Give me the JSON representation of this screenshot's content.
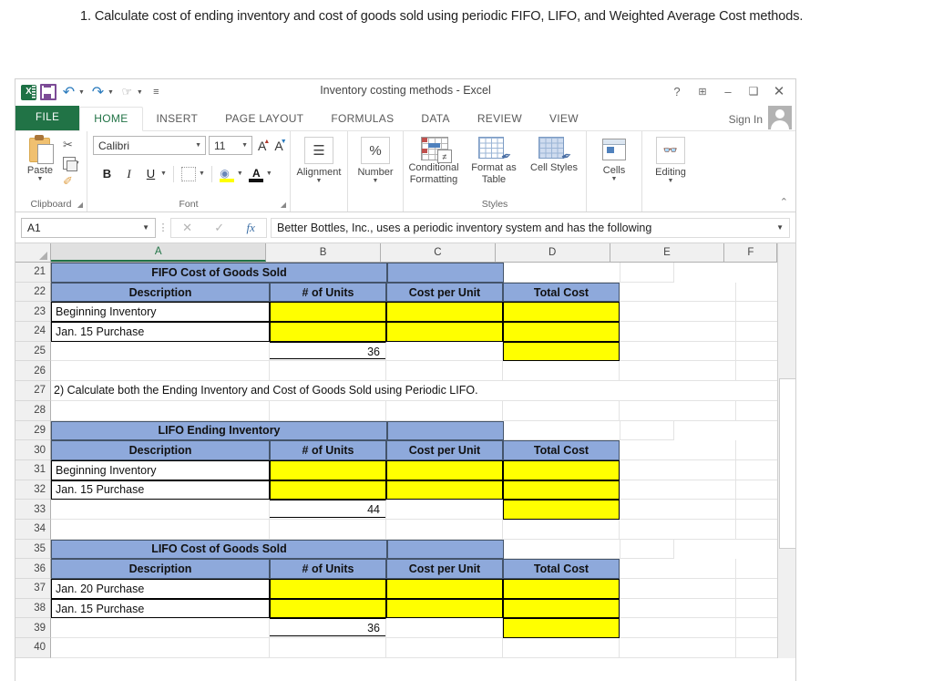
{
  "question": "1. Calculate cost of ending inventory and cost of goods sold using periodic FIFO, LIFO, and Weighted Average Cost methods.",
  "window": {
    "title": "Inventory costing methods - Excel",
    "help_icon": "?",
    "ribbon_display_icon": "ribbon-options-icon",
    "minimize_icon": "–",
    "restore_icon": "❐",
    "close_icon": "✕",
    "sign_in": "Sign In"
  },
  "quick_access": {
    "app_logo": "X",
    "save": "save-icon",
    "undo": "↶",
    "redo": "↷",
    "touch_mode": "touch-mode-icon",
    "customize": "═"
  },
  "tabs": [
    {
      "label": "FILE",
      "active": false,
      "file": true
    },
    {
      "label": "HOME",
      "active": true,
      "file": false
    },
    {
      "label": "INSERT",
      "active": false,
      "file": false
    },
    {
      "label": "PAGE LAYOUT",
      "active": false,
      "file": false
    },
    {
      "label": "FORMULAS",
      "active": false,
      "file": false
    },
    {
      "label": "DATA",
      "active": false,
      "file": false
    },
    {
      "label": "REVIEW",
      "active": false,
      "file": false
    },
    {
      "label": "VIEW",
      "active": false,
      "file": false
    }
  ],
  "ribbon": {
    "clipboard": {
      "group_label": "Clipboard",
      "paste_label": "Paste",
      "cut_icon": "scissors-icon",
      "copy_icon": "copy-icon",
      "format_painter_icon": "format-painter-icon"
    },
    "font": {
      "group_label": "Font",
      "font_name": "Calibri",
      "font_size": "11",
      "grow_font": "A",
      "shrink_font": "A",
      "bold": "B",
      "italic": "I",
      "underline": "U",
      "borders_icon": "borders-icon",
      "fill_color_icon": "fill-color-icon",
      "font_color_icon": "font-color-icon"
    },
    "alignment": {
      "group_label": "Alignment",
      "label": "Alignment"
    },
    "number": {
      "group_label": "Number",
      "label": "Number",
      "percent": "%"
    },
    "styles": {
      "group_label": "Styles",
      "conditional_formatting": "Conditional Formatting",
      "format_as_table": "Format as Table",
      "cell_styles": "Cell Styles"
    },
    "cells": {
      "label": "Cells"
    },
    "editing": {
      "label": "Editing"
    },
    "collapse_icon": "⌃"
  },
  "formula_bar": {
    "name_box": "A1",
    "cancel_icon": "✕",
    "enter_icon": "✓",
    "function_icon": "fx",
    "content": "Better Bottles, Inc., uses a periodic inventory system and has the following"
  },
  "grid": {
    "columns": [
      "A",
      "B",
      "C",
      "D",
      "E",
      "F"
    ],
    "selected_column": "A",
    "rows": [
      {
        "n": "21",
        "cells": [
          {
            "c": "A",
            "v": "FIFO Cost of Goods Sold",
            "style": "titleblue",
            "span": 3
          },
          {
            "c": "D",
            "v": "",
            "style": "titleblue"
          },
          {
            "c": "E",
            "v": "",
            "style": "plain"
          },
          {
            "c": "F",
            "v": "",
            "style": "plain"
          }
        ]
      },
      {
        "n": "22",
        "cells": [
          {
            "c": "A",
            "v": "Description",
            "style": "hdrblue"
          },
          {
            "c": "B",
            "v": "# of Units",
            "style": "hdrblue"
          },
          {
            "c": "C",
            "v": "Cost per Unit",
            "style": "hdrblue"
          },
          {
            "c": "D",
            "v": "Total Cost",
            "style": "hdrblue"
          },
          {
            "c": "E",
            "v": "",
            "style": "plain"
          },
          {
            "c": "F",
            "v": "",
            "style": "plain"
          }
        ]
      },
      {
        "n": "23",
        "cells": [
          {
            "c": "A",
            "v": "Beginning Inventory",
            "style": "desc"
          },
          {
            "c": "B",
            "v": "",
            "style": "yellow"
          },
          {
            "c": "C",
            "v": "",
            "style": "yellow"
          },
          {
            "c": "D",
            "v": "",
            "style": "yellow"
          },
          {
            "c": "E",
            "v": "",
            "style": "plain"
          },
          {
            "c": "F",
            "v": "",
            "style": "plain"
          }
        ]
      },
      {
        "n": "24",
        "cells": [
          {
            "c": "A",
            "v": "Jan. 15 Purchase",
            "style": "desc"
          },
          {
            "c": "B",
            "v": "",
            "style": "yellow"
          },
          {
            "c": "C",
            "v": "",
            "style": "yellow"
          },
          {
            "c": "D",
            "v": "",
            "style": "yellow"
          },
          {
            "c": "E",
            "v": "",
            "style": "plain"
          },
          {
            "c": "F",
            "v": "",
            "style": "plain"
          }
        ]
      },
      {
        "n": "25",
        "cells": [
          {
            "c": "A",
            "v": "",
            "style": "plain"
          },
          {
            "c": "B",
            "v": "36",
            "style": "total"
          },
          {
            "c": "C",
            "v": "",
            "style": "plain"
          },
          {
            "c": "D",
            "v": "",
            "style": "yellow"
          },
          {
            "c": "E",
            "v": "",
            "style": "plain"
          },
          {
            "c": "F",
            "v": "",
            "style": "plain"
          }
        ]
      },
      {
        "n": "26",
        "cells": [
          {
            "c": "A",
            "v": "",
            "style": "plain"
          },
          {
            "c": "B",
            "v": "",
            "style": "plain"
          },
          {
            "c": "C",
            "v": "",
            "style": "plain"
          },
          {
            "c": "D",
            "v": "",
            "style": "plain"
          },
          {
            "c": "E",
            "v": "",
            "style": "plain"
          },
          {
            "c": "F",
            "v": "",
            "style": "plain"
          }
        ]
      },
      {
        "n": "27",
        "cells": [
          {
            "c": "A",
            "v": "2) Calculate both the Ending Inventory and Cost of Goods Sold using Periodic LIFO.",
            "style": "text",
            "span": 6
          }
        ]
      },
      {
        "n": "28",
        "cells": [
          {
            "c": "A",
            "v": "",
            "style": "plain"
          },
          {
            "c": "B",
            "v": "",
            "style": "plain"
          },
          {
            "c": "C",
            "v": "",
            "style": "plain"
          },
          {
            "c": "D",
            "v": "",
            "style": "plain"
          },
          {
            "c": "E",
            "v": "",
            "style": "plain"
          },
          {
            "c": "F",
            "v": "",
            "style": "plain"
          }
        ]
      },
      {
        "n": "29",
        "cells": [
          {
            "c": "A",
            "v": "LIFO Ending Inventory",
            "style": "titleblue",
            "span": 3
          },
          {
            "c": "D",
            "v": "",
            "style": "titleblue"
          },
          {
            "c": "E",
            "v": "",
            "style": "plain"
          },
          {
            "c": "F",
            "v": "",
            "style": "plain"
          }
        ]
      },
      {
        "n": "30",
        "cells": [
          {
            "c": "A",
            "v": "Description",
            "style": "hdrblue"
          },
          {
            "c": "B",
            "v": "# of Units",
            "style": "hdrblue"
          },
          {
            "c": "C",
            "v": "Cost per Unit",
            "style": "hdrblue"
          },
          {
            "c": "D",
            "v": "Total Cost",
            "style": "hdrblue"
          },
          {
            "c": "E",
            "v": "",
            "style": "plain"
          },
          {
            "c": "F",
            "v": "",
            "style": "plain"
          }
        ]
      },
      {
        "n": "31",
        "cells": [
          {
            "c": "A",
            "v": "Beginning Inventory",
            "style": "desc"
          },
          {
            "c": "B",
            "v": "",
            "style": "yellow"
          },
          {
            "c": "C",
            "v": "",
            "style": "yellow"
          },
          {
            "c": "D",
            "v": "",
            "style": "yellow"
          },
          {
            "c": "E",
            "v": "",
            "style": "plain"
          },
          {
            "c": "F",
            "v": "",
            "style": "plain"
          }
        ]
      },
      {
        "n": "32",
        "cells": [
          {
            "c": "A",
            "v": "Jan. 15 Purchase",
            "style": "desc"
          },
          {
            "c": "B",
            "v": "",
            "style": "yellow"
          },
          {
            "c": "C",
            "v": "",
            "style": "yellow"
          },
          {
            "c": "D",
            "v": "",
            "style": "yellow"
          },
          {
            "c": "E",
            "v": "",
            "style": "plain"
          },
          {
            "c": "F",
            "v": "",
            "style": "plain"
          }
        ]
      },
      {
        "n": "33",
        "cells": [
          {
            "c": "A",
            "v": "",
            "style": "plain"
          },
          {
            "c": "B",
            "v": "44",
            "style": "total"
          },
          {
            "c": "C",
            "v": "",
            "style": "plain"
          },
          {
            "c": "D",
            "v": "",
            "style": "yellow"
          },
          {
            "c": "E",
            "v": "",
            "style": "plain"
          },
          {
            "c": "F",
            "v": "",
            "style": "plain"
          }
        ]
      },
      {
        "n": "34",
        "cells": [
          {
            "c": "A",
            "v": "",
            "style": "plain"
          },
          {
            "c": "B",
            "v": "",
            "style": "plain"
          },
          {
            "c": "C",
            "v": "",
            "style": "plain"
          },
          {
            "c": "D",
            "v": "",
            "style": "plain"
          },
          {
            "c": "E",
            "v": "",
            "style": "plain"
          },
          {
            "c": "F",
            "v": "",
            "style": "plain"
          }
        ]
      },
      {
        "n": "35",
        "cells": [
          {
            "c": "A",
            "v": "LIFO Cost of Goods Sold",
            "style": "titleblue",
            "span": 3
          },
          {
            "c": "D",
            "v": "",
            "style": "titleblue"
          },
          {
            "c": "E",
            "v": "",
            "style": "plain"
          },
          {
            "c": "F",
            "v": "",
            "style": "plain"
          }
        ]
      },
      {
        "n": "36",
        "cells": [
          {
            "c": "A",
            "v": "Description",
            "style": "hdrblue"
          },
          {
            "c": "B",
            "v": "# of Units",
            "style": "hdrblue"
          },
          {
            "c": "C",
            "v": "Cost per Unit",
            "style": "hdrblue"
          },
          {
            "c": "D",
            "v": "Total Cost",
            "style": "hdrblue"
          },
          {
            "c": "E",
            "v": "",
            "style": "plain"
          },
          {
            "c": "F",
            "v": "",
            "style": "plain"
          }
        ]
      },
      {
        "n": "37",
        "cells": [
          {
            "c": "A",
            "v": "Jan. 20 Purchase",
            "style": "desc"
          },
          {
            "c": "B",
            "v": "",
            "style": "yellow"
          },
          {
            "c": "C",
            "v": "",
            "style": "yellow"
          },
          {
            "c": "D",
            "v": "",
            "style": "yellow"
          },
          {
            "c": "E",
            "v": "",
            "style": "plain"
          },
          {
            "c": "F",
            "v": "",
            "style": "plain"
          }
        ]
      },
      {
        "n": "38",
        "cells": [
          {
            "c": "A",
            "v": "Jan. 15 Purchase",
            "style": "desc"
          },
          {
            "c": "B",
            "v": "",
            "style": "yellow"
          },
          {
            "c": "C",
            "v": "",
            "style": "yellow"
          },
          {
            "c": "D",
            "v": "",
            "style": "yellow"
          },
          {
            "c": "E",
            "v": "",
            "style": "plain"
          },
          {
            "c": "F",
            "v": "",
            "style": "plain"
          }
        ]
      },
      {
        "n": "39",
        "cells": [
          {
            "c": "A",
            "v": "",
            "style": "plain"
          },
          {
            "c": "B",
            "v": "36",
            "style": "total"
          },
          {
            "c": "C",
            "v": "",
            "style": "plain"
          },
          {
            "c": "D",
            "v": "",
            "style": "yellow"
          },
          {
            "c": "E",
            "v": "",
            "style": "plain"
          },
          {
            "c": "F",
            "v": "",
            "style": "plain"
          }
        ]
      },
      {
        "n": "40",
        "cells": [
          {
            "c": "A",
            "v": "",
            "style": "plain"
          },
          {
            "c": "B",
            "v": "",
            "style": "plain"
          },
          {
            "c": "C",
            "v": "",
            "style": "plain"
          },
          {
            "c": "D",
            "v": "",
            "style": "plain"
          },
          {
            "c": "E",
            "v": "",
            "style": "plain"
          },
          {
            "c": "F",
            "v": "",
            "style": "plain"
          }
        ]
      }
    ]
  },
  "colors": {
    "header_blue": "#8EA9DB",
    "input_yellow": "#FFFF00",
    "excel_green": "#217346",
    "border_dark": "#44546A"
  }
}
